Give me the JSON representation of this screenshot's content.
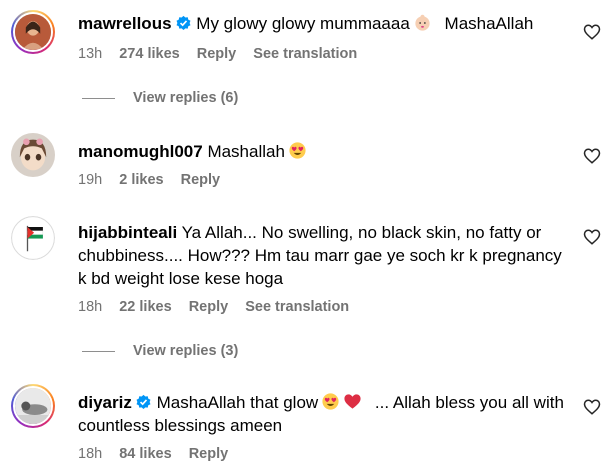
{
  "comments": [
    {
      "username": "mawrellous",
      "verified": true,
      "text": "My glowy glowy mummaaaa",
      "text_after": "MashaAllah",
      "emoji": "baby-emoji",
      "time": "13h",
      "likes": "274 likes",
      "reply": "Reply",
      "translate": "See translation",
      "view_replies": "View replies (6)"
    },
    {
      "username": "manomughl007",
      "verified": false,
      "text": "Mashallah",
      "emoji": "heart-eyes-emoji",
      "time": "19h",
      "likes": "2 likes",
      "reply": "Reply"
    },
    {
      "username": "hijabbinteali",
      "verified": false,
      "text": "Ya Allah... No swelling, no black skin, no fatty or chubbiness.... How??? Hm tau marr gae ye soch kr k pregnancy k bd weight lose kese hoga",
      "time": "18h",
      "likes": "22 likes",
      "reply": "Reply",
      "translate": "See translation",
      "view_replies": "View replies (3)"
    },
    {
      "username": "diyariz",
      "verified": true,
      "text": "MashaAllah that glow",
      "emoji": [
        "heart-eyes-emoji",
        "red-heart-emoji"
      ],
      "text_after": "... Allah bless you all with countless blessings ameen",
      "time": "18h",
      "likes": "84 likes",
      "reply": "Reply"
    }
  ],
  "colors": {
    "meta_text": "#737373",
    "verified_blue": "#0095f6",
    "heart_emoji": "#e0245e"
  }
}
